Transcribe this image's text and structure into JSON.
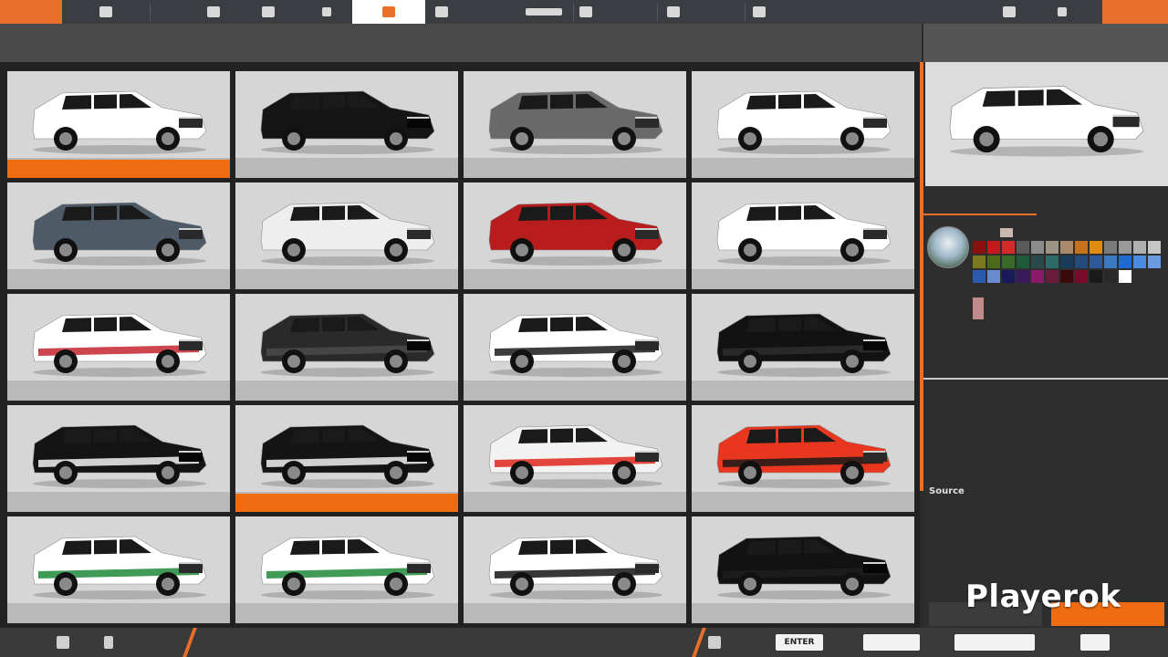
{
  "topbar": {
    "buttons": [
      {
        "name": "tab-vehicles",
        "icon": "vehicle-icon"
      },
      {
        "name": "tab-spawn",
        "icon": "car-spawn-icon"
      },
      {
        "name": "tab-parts",
        "icon": "puzzle-icon"
      },
      {
        "name": "tab-mods",
        "icon": "mods-icon"
      },
      {
        "name": "tab-paint",
        "icon": "paint-icon",
        "active": true
      },
      {
        "name": "tab-engine",
        "icon": "engine-icon"
      },
      {
        "name": "tab-tuning",
        "icon": "tuning-icon"
      },
      {
        "name": "tab-weather",
        "icon": "weather-icon"
      },
      {
        "name": "tab-photo",
        "icon": "camera-icon"
      },
      {
        "name": "tab-map",
        "icon": "map-icon"
      },
      {
        "name": "tab-settings",
        "icon": "sliders-icon"
      },
      {
        "name": "tab-debug",
        "icon": "bug-icon"
      }
    ],
    "accent_color": "#e8702a"
  },
  "grid": {
    "tiles": [
      {
        "body": "#ffffff",
        "stripe": "",
        "selected": true
      },
      {
        "body": "#151515",
        "stripe": "",
        "selected": false
      },
      {
        "body": "#6a6a6a",
        "stripe": "",
        "selected": false
      },
      {
        "body": "#ffffff",
        "stripe": "",
        "selected": false
      },
      {
        "body": "#4e5a66",
        "stripe": "",
        "selected": false
      },
      {
        "body": "#eeeeee",
        "stripe": "",
        "selected": false
      },
      {
        "body": "#b81c1c",
        "stripe": "",
        "selected": false
      },
      {
        "body": "#ffffff",
        "stripe": "",
        "selected": false
      },
      {
        "body": "#ffffff",
        "stripe": "#c4262e",
        "selected": false
      },
      {
        "body": "#2a2a2a",
        "stripe": "#4a4a4a",
        "selected": false
      },
      {
        "body": "#ffffff",
        "stripe": "#1b1b1b",
        "selected": false
      },
      {
        "body": "#121212",
        "stripe": "#2e2e2e",
        "selected": false
      },
      {
        "body": "#141414",
        "stripe": "#f2f2f2",
        "selected": false
      },
      {
        "body": "#141414",
        "stripe": "#f2f2f2",
        "selected": true
      },
      {
        "body": "#f2f2f2",
        "stripe": "#e1261c",
        "selected": false
      },
      {
        "body": "#e8371e",
        "stripe": "#1a1a1a",
        "selected": false
      },
      {
        "body": "#ffffff",
        "stripe": "#1f8a3a",
        "selected": false
      },
      {
        "body": "#ffffff",
        "stripe": "#1f8a3a",
        "selected": false
      },
      {
        "body": "#ffffff",
        "stripe": "#151515",
        "selected": false
      },
      {
        "body": "#121212",
        "stripe": "#1e1e1e",
        "selected": false
      }
    ]
  },
  "rpanel": {
    "source_label": "Source",
    "preview_body": "#ffffff",
    "swatches": [
      "#8a1010",
      "#c21a1a",
      "#d62a2a",
      "#5a5a5a",
      "#8a8a8a",
      "#9e9486",
      "#a88a6a",
      "#c4731c",
      "#e08a10",
      "#7a7a7a",
      "#9a9a9a",
      "#b0b0b0",
      "#c6c6c6",
      "#7a7a20",
      "#4a6a1a",
      "#3a6a2a",
      "#1e5a3a",
      "#2a4a4a",
      "#2e6a6a",
      "#1a3a5a",
      "#264a7a",
      "#2e5a9a",
      "#3a7ac0",
      "#1e6ad0",
      "#4a8ae0",
      "#6a9ae0",
      "#2a5ab0",
      "#6a8ad0",
      "#1a1a5a",
      "#3a1a5a",
      "#8a1a6a",
      "#6a1a3a",
      "#3a0a0a",
      "#7a0a2a",
      "#1a1a1a",
      "#2a2a2a",
      "#ffffff"
    ]
  },
  "watermark": "Playerok",
  "bottombar": {
    "enter_label": "ENTER"
  }
}
